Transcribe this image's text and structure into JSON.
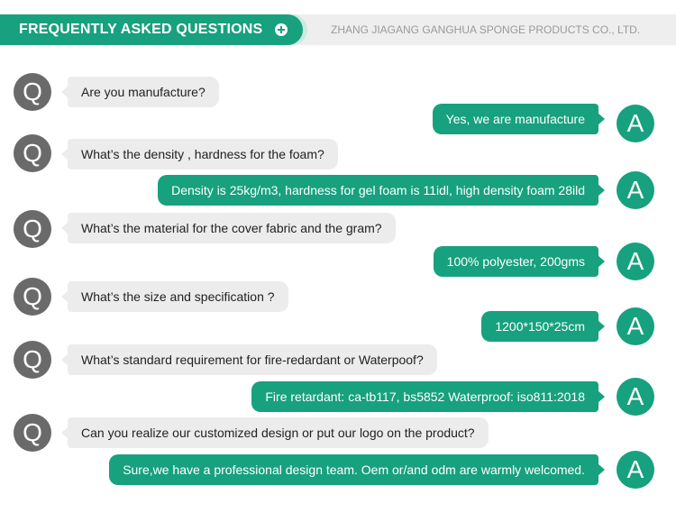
{
  "header": {
    "title": "FREQUENTLY ASKED QUESTIONS",
    "plus_icon": "plus-circle-icon",
    "company": "ZHANG JIAGANG GANGHUA SPONGE PRODUCTS CO., LTD."
  },
  "avatar_labels": {
    "question": "Q",
    "answer": "A"
  },
  "faqs": [
    {
      "question": "Are you manufacture?",
      "answer": "Yes, we are manufacture"
    },
    {
      "question": "What’s the density , hardness for the foam?",
      "answer": "Density is 25kg/m3, hardness for gel foam is 11idl, high density foam 28ild"
    },
    {
      "question": "What’s the material for the cover fabric and the gram?",
      "answer": "100% polyester, 200gms"
    },
    {
      "question": "What’s the size and specification ?",
      "answer": "1200*150*25cm"
    },
    {
      "question": "What’s standard requirement for fire-redardant or Waterpoof?",
      "answer": "Fire retardant: ca-tb117, bs5852   Waterproof: iso811:2018"
    },
    {
      "question": "Can you realize our customized design or put our logo on the product?",
      "answer": "Sure,we have a professional design team. Oem or/and odm are warmly welcomed."
    }
  ],
  "colors": {
    "accent": "#17a17e",
    "question_avatar": "#6a6a6a",
    "question_bubble": "#ececec",
    "header_bg": "#eeeeee"
  }
}
